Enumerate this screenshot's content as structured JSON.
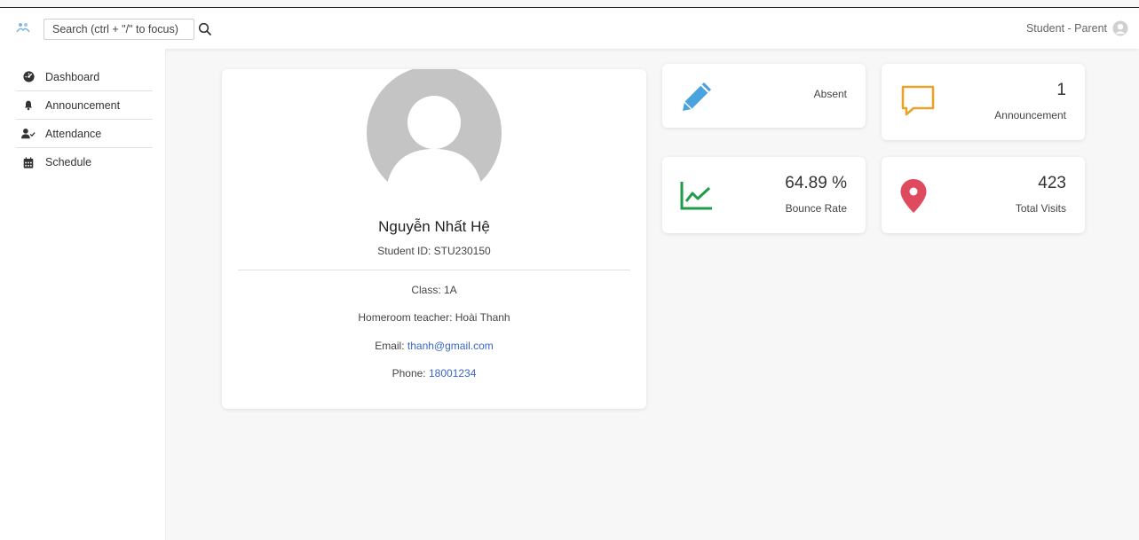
{
  "header": {
    "search_placeholder": "Search (ctrl + \"/\" to focus)",
    "user_role": "Student - Parent"
  },
  "sidebar": {
    "items": [
      {
        "label": "Dashboard",
        "icon": "dashboard-icon"
      },
      {
        "label": "Announcement",
        "icon": "bell-icon"
      },
      {
        "label": "Attendance",
        "icon": "user-check-icon"
      },
      {
        "label": "Schedule",
        "icon": "calendar-icon"
      }
    ]
  },
  "profile": {
    "name": "Nguyễn Nhất Hệ",
    "student_id": "Student ID: STU230150",
    "class": "Class: 1A",
    "homeroom": "Homeroom teacher: Hoài Thanh",
    "email_label": "Email:",
    "email": "thanh@gmail.com",
    "phone_label": "Phone:",
    "phone": "18001234"
  },
  "stats": {
    "absent": {
      "value": "",
      "label": "Absent",
      "icon": "pencil-icon",
      "color": "#4aa3df"
    },
    "announcement": {
      "value": "1",
      "label": "Announcement",
      "icon": "speech-bubble-icon",
      "color": "#e8a32b"
    },
    "bounce": {
      "value": "64.89 %",
      "label": "Bounce Rate",
      "icon": "line-chart-icon",
      "color": "#1f9d4a"
    },
    "visits": {
      "value": "423",
      "label": "Total Visits",
      "icon": "map-pin-icon",
      "color": "#e04a5f"
    }
  }
}
